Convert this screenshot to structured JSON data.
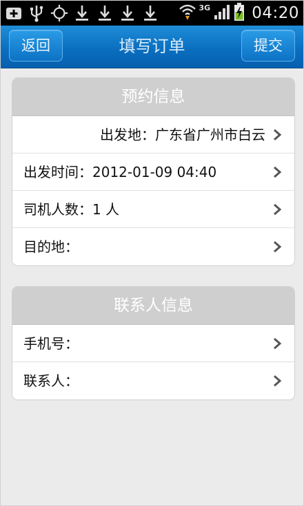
{
  "status_bar": {
    "time": "04:20",
    "network": "3G",
    "icons": [
      "plus-box-icon",
      "usb-icon",
      "gps-icon",
      "download-icon",
      "download-icon",
      "download-icon",
      "download-icon"
    ]
  },
  "header": {
    "back_label": "返回",
    "title": "填写订单",
    "submit_label": "提交"
  },
  "reservation": {
    "title": "预约信息",
    "rows": [
      {
        "text": "出发地：广东省广州市白云"
      },
      {
        "text": "出发时间：2012-01-09 04:40"
      },
      {
        "text": "司机人数：1 人"
      },
      {
        "text": "目的地："
      }
    ]
  },
  "contact": {
    "title": "联系人信息",
    "rows": [
      {
        "text": "手机号："
      },
      {
        "text": "联系人："
      }
    ]
  },
  "colors": {
    "header_blue": "#0a6fc0",
    "card_header_gray": "#cfcfcf",
    "background": "#ebebeb"
  }
}
